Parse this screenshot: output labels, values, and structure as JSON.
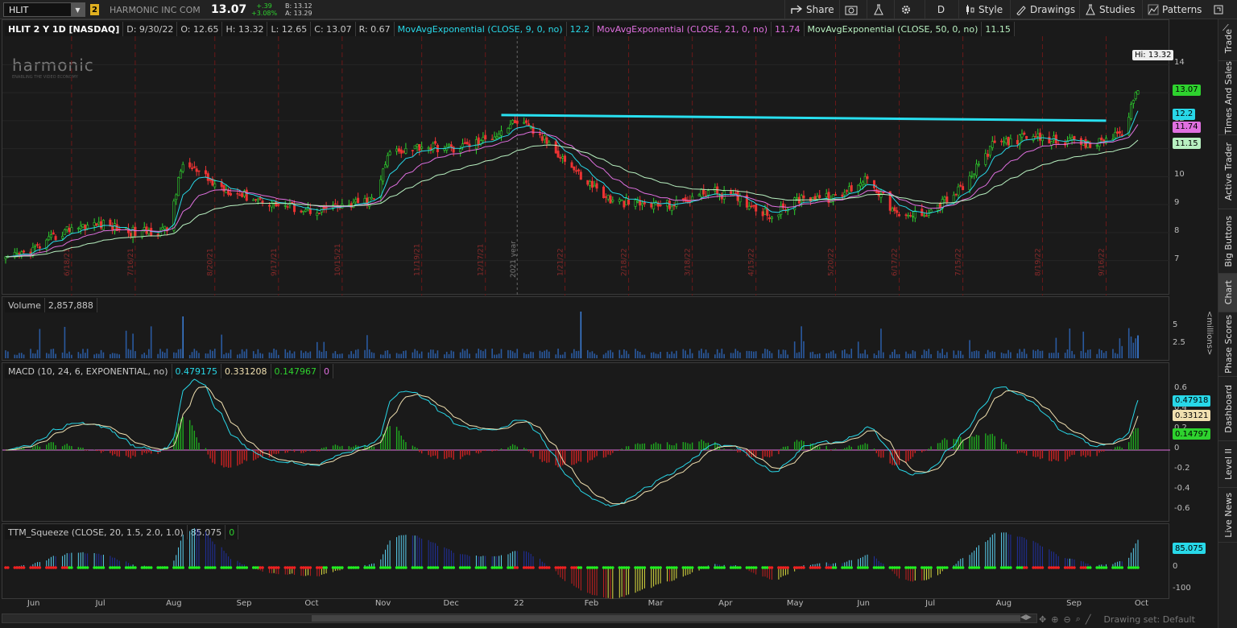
{
  "toolbar": {
    "symbol": "HLIT",
    "link_badge": "2",
    "company": "HARMONIC INC COM",
    "last": "13.07",
    "change": "+.39",
    "change_pct": "+3.08%",
    "bid": "B: 13.12",
    "ask": "A: 13.29",
    "share_label": "Share",
    "timeframe_label": "D",
    "style_label": "Style",
    "drawings_label": "Drawings",
    "studies_label": "Studies",
    "patterns_label": "Patterns"
  },
  "price_pane": {
    "info": [
      "HLIT 2 Y 1D [NASDAQ]",
      "D: 9/30/22",
      "O: 12.65",
      "H: 13.32",
      "L: 12.65",
      "C: 13.07",
      "R: 0.67"
    ],
    "studies": [
      {
        "label": "MovAvgExponential (CLOSE, 9, 0, no)",
        "value": "12.2",
        "color": "#28d8e8"
      },
      {
        "label": "MovAvgExponential (CLOSE, 21, 0, no)",
        "value": "11.74",
        "color": "#e070e0"
      },
      {
        "label": "MovAvgExponential (CLOSE, 50, 0, no)",
        "value": "11.15",
        "color": "#b8f0c0"
      }
    ],
    "hi_label": "Hi: 13.32",
    "tags": [
      {
        "text": "13.07",
        "color": "#2ed22e",
        "value": 13.07
      },
      {
        "text": "12.2",
        "color": "#28d8e8",
        "value": 12.2
      },
      {
        "text": "11.74",
        "color": "#e070e0",
        "value": 11.74
      },
      {
        "text": "11.15",
        "color": "#b8f0c0",
        "value": 11.15
      }
    ],
    "yticks": [
      "14",
      "13",
      "12",
      "11",
      "10",
      "9",
      "8",
      "7"
    ],
    "date_markers": [
      "6/18/21",
      "7/16/21",
      "8/20/21",
      "9/17/21",
      "10/15/21",
      "11/19/21",
      "12/17/21",
      "1/21/22",
      "2/18/22",
      "3/18/22",
      "4/15/22",
      "5/20/22",
      "6/17/22",
      "7/15/22",
      "8/19/22",
      "9/16/22"
    ],
    "year_marker": "2021 year",
    "logo_text": "harmonic",
    "logo_tagline": "ENABLING THE VIDEO ECONOMY"
  },
  "volume_pane": {
    "label": "Volume",
    "value": "2,857,888",
    "yticks": [
      "5",
      "2.5"
    ],
    "unit": "<millions>"
  },
  "macd_pane": {
    "label": "MACD (10, 24, 6, EXPONENTIAL, no)",
    "values": [
      "0.479175",
      "0.331208",
      "0.147967",
      "0"
    ],
    "yticks": [
      "0.6",
      "0.4",
      "0.2",
      "0",
      "-0.2",
      "-0.4",
      "-0.6"
    ],
    "tags": [
      {
        "text": "0.47918",
        "color": "#28d8e8"
      },
      {
        "text": "0.33121",
        "color": "#f0e0b0"
      },
      {
        "text": "0.14797",
        "color": "#2ed22e"
      }
    ]
  },
  "ttm_pane": {
    "label": "TTM_Squeeze (CLOSE, 20, 1.5, 2.0, 1.0)",
    "values": [
      "85.075",
      "0"
    ],
    "yticks": [
      "0",
      "-100"
    ],
    "tag": "85.075"
  },
  "x_axis": [
    "Jun",
    "Jul",
    "Aug",
    "Sep",
    "Oct",
    "Nov",
    "Dec",
    "22",
    "Feb",
    "Mar",
    "Apr",
    "May",
    "Jun",
    "Jul",
    "Aug",
    "Sep",
    "Oct"
  ],
  "sidebar_tabs": [
    "Trade",
    "Times And Sales",
    "Active Trader",
    "Big Buttons",
    "Chart",
    "Phase Scores",
    "Dashboard",
    "Level II",
    "Live News"
  ],
  "bottom": {
    "drawing_set": "Drawing set: Default"
  },
  "chart_data": {
    "type": "candlestick",
    "title": "HLIT 2 Y 1D [NASDAQ]",
    "ylim": [
      6.5,
      14.5
    ],
    "close_path": [
      {
        "x": "2021-05-20",
        "y": 7.0
      },
      {
        "x": "2021-06-04",
        "y": 7.5
      },
      {
        "x": "2021-06-18",
        "y": 8.2
      },
      {
        "x": "2021-07-02",
        "y": 8.3
      },
      {
        "x": "2021-07-16",
        "y": 8.0
      },
      {
        "x": "2021-07-30",
        "y": 8.1
      },
      {
        "x": "2021-08-06",
        "y": 10.5
      },
      {
        "x": "2021-08-20",
        "y": 9.7
      },
      {
        "x": "2021-09-03",
        "y": 9.3
      },
      {
        "x": "2021-09-17",
        "y": 9.0
      },
      {
        "x": "2021-10-01",
        "y": 8.8
      },
      {
        "x": "2021-10-15",
        "y": 8.9
      },
      {
        "x": "2021-10-29",
        "y": 9.2
      },
      {
        "x": "2021-11-05",
        "y": 10.9
      },
      {
        "x": "2021-11-19",
        "y": 11.1
      },
      {
        "x": "2021-12-03",
        "y": 11.0
      },
      {
        "x": "2021-12-17",
        "y": 11.3
      },
      {
        "x": "2021-12-31",
        "y": 12.0
      },
      {
        "x": "2022-01-14",
        "y": 11.2
      },
      {
        "x": "2022-01-28",
        "y": 10.0
      },
      {
        "x": "2022-02-11",
        "y": 9.1
      },
      {
        "x": "2022-02-25",
        "y": 9.0
      },
      {
        "x": "2022-03-11",
        "y": 9.0
      },
      {
        "x": "2022-03-25",
        "y": 9.5
      },
      {
        "x": "2022-04-08",
        "y": 9.2
      },
      {
        "x": "2022-04-22",
        "y": 8.6
      },
      {
        "x": "2022-05-06",
        "y": 9.3
      },
      {
        "x": "2022-05-20",
        "y": 9.2
      },
      {
        "x": "2022-06-03",
        "y": 10.0
      },
      {
        "x": "2022-06-17",
        "y": 8.5
      },
      {
        "x": "2022-07-01",
        "y": 8.8
      },
      {
        "x": "2022-07-15",
        "y": 9.6
      },
      {
        "x": "2022-07-29",
        "y": 11.2
      },
      {
        "x": "2022-08-12",
        "y": 11.4
      },
      {
        "x": "2022-08-26",
        "y": 11.3
      },
      {
        "x": "2022-09-09",
        "y": 11.1
      },
      {
        "x": "2022-09-23",
        "y": 11.6
      },
      {
        "x": "2022-09-30",
        "y": 13.07
      }
    ],
    "resistance_line": {
      "from": {
        "x": "2021-12-24",
        "y": 12.2
      },
      "to": {
        "x": "2022-09-16",
        "y": 12.0
      },
      "color": "#28e0f0"
    }
  }
}
